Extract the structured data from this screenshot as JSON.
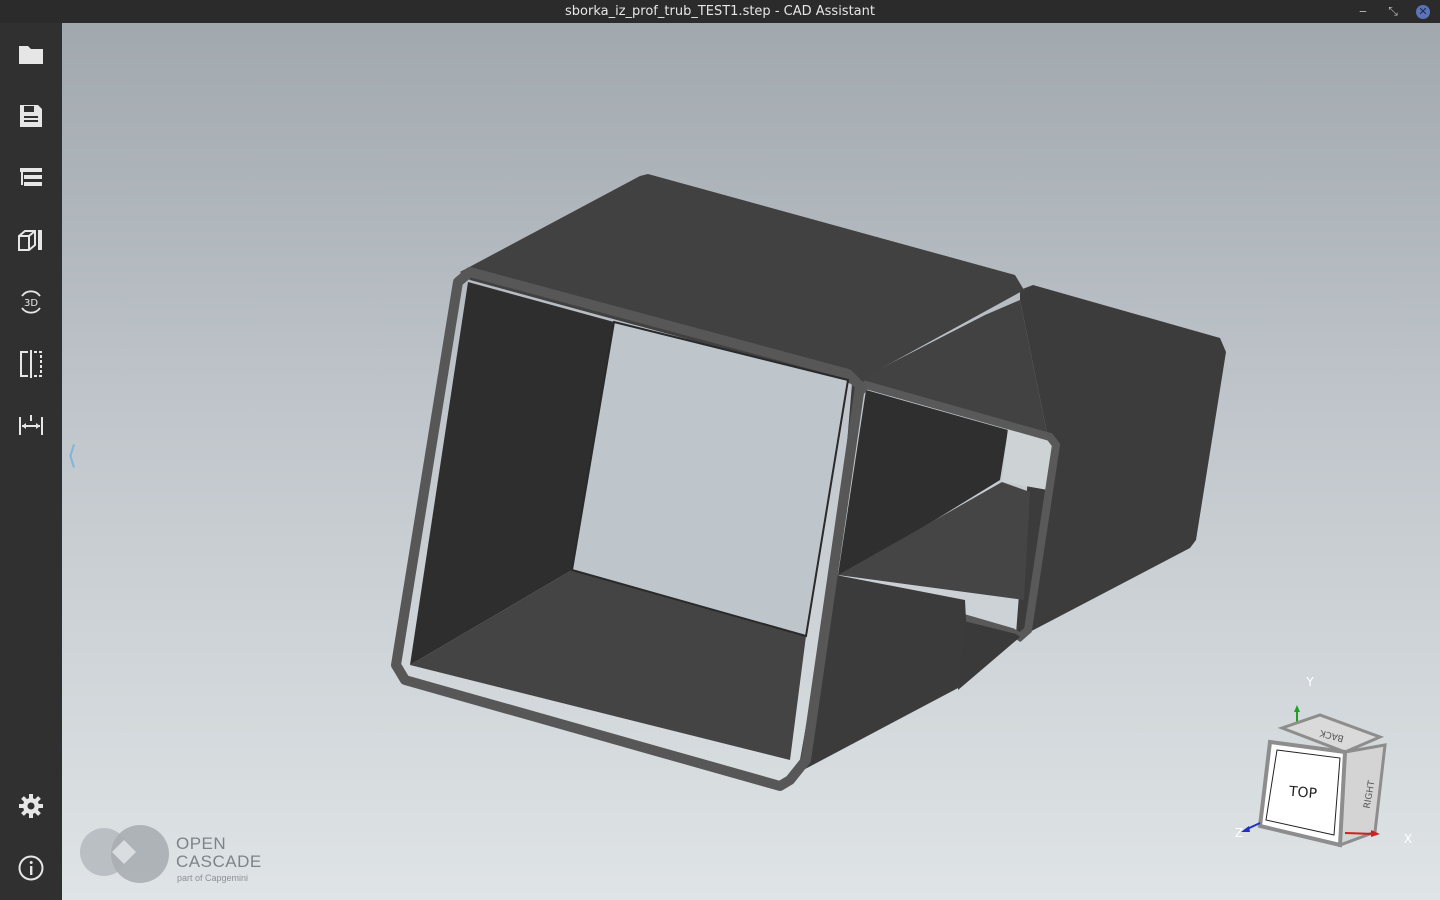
{
  "window": {
    "title": "sborka_iz_prof_trub_TEST1.step - CAD Assistant",
    "minimize_icon": "minimize-icon",
    "restore_icon": "restore-icon",
    "close_icon": "close-icon"
  },
  "sidebar": {
    "items": [
      {
        "icon": "folder-icon",
        "tooltip": ""
      },
      {
        "icon": "save-icon",
        "tooltip": ""
      },
      {
        "icon": "model-tree-icon",
        "tooltip": ""
      },
      {
        "icon": "view-parts-icon",
        "tooltip": ""
      },
      {
        "icon": "rotate-3d-icon",
        "label": "3D"
      },
      {
        "icon": "section-clip-icon",
        "tooltip": ""
      },
      {
        "icon": "measure-icon",
        "tooltip": ""
      }
    ],
    "settings_icon": "gear-icon",
    "info_icon": "info-icon",
    "collapse_glyph": "⟨"
  },
  "logo": {
    "line1": "OPEN",
    "line2": "CASCADE",
    "line3": "part of Capgemini"
  },
  "view_cube": {
    "top": "TOP",
    "right": "RIGHT",
    "back": "BACK",
    "axis_y": "Y",
    "axis_x": "X",
    "axis_z": "Z",
    "colors": {
      "x": "#d02020",
      "y": "#20a020",
      "z": "#2030c0"
    }
  },
  "model": {
    "color": "#3e3e3e",
    "edge_color": "#555555"
  }
}
